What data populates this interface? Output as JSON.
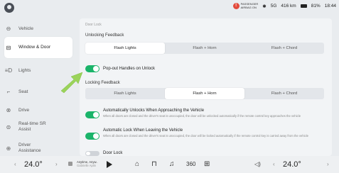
{
  "status": {
    "passenger_airbag_line1": "PASSENGER",
    "passenger_airbag_line2": "AIRBAG ON",
    "range": "416 km",
    "battery": "81%",
    "time": "18:44",
    "signal": "5G"
  },
  "sidebar": {
    "items": [
      {
        "label": "Vehicle",
        "icon": "car-icon"
      },
      {
        "label": "Window & Door",
        "icon": "window-door-icon",
        "active": true
      },
      {
        "label": "Lights",
        "icon": "lights-icon"
      },
      {
        "label": "Seat",
        "icon": "seat-icon"
      },
      {
        "label": "Drive",
        "icon": "steering-wheel-icon"
      },
      {
        "label": "Real-time SR Assist",
        "icon": "sr-assist-icon"
      },
      {
        "label": "Driver Assistance",
        "icon": "driver-assistance-icon"
      }
    ]
  },
  "main": {
    "breadcrumb": "Door Lock",
    "unlocking_feedback": {
      "title": "Unlocking Feedback",
      "options": [
        "Flash Lights",
        "Flash + Horn",
        "Flash + Chord"
      ],
      "selected": "Flash Lights"
    },
    "popout_handles": {
      "label": "Pop-out Handles on Unlock",
      "enabled": true
    },
    "locking_feedback": {
      "title": "Locking Feedback",
      "options": [
        "Flash Lights",
        "Flash + Horn",
        "Flash + Chord"
      ],
      "selected": "Flash + Horn"
    },
    "auto_unlock": {
      "title": "Automatically Unlocks When Approaching the Vehicle",
      "desc": "When all doors are closed and the driver's seat is unoccupied, the door will be unlocked automatically if the remote control key approaches the vehicle",
      "enabled": true
    },
    "auto_lock": {
      "title": "Automatic Lock When Leaving the Vehicle",
      "desc": "When all doors are closed and the driver's seat is unoccupied, the door will be locked automatically if the remote control key is carried away from the vehicle",
      "enabled": true
    },
    "door_lock": {
      "title": "Door Lock",
      "enabled": false
    }
  },
  "dock": {
    "temp_left": "24.0°",
    "temp_right": "24.0°",
    "media_title": "Anytime, Anyw..",
    "media_sub": "Gabrielle Aplin"
  },
  "colors": {
    "accent": "#1bb46a",
    "arrow": "#9bd35a"
  }
}
